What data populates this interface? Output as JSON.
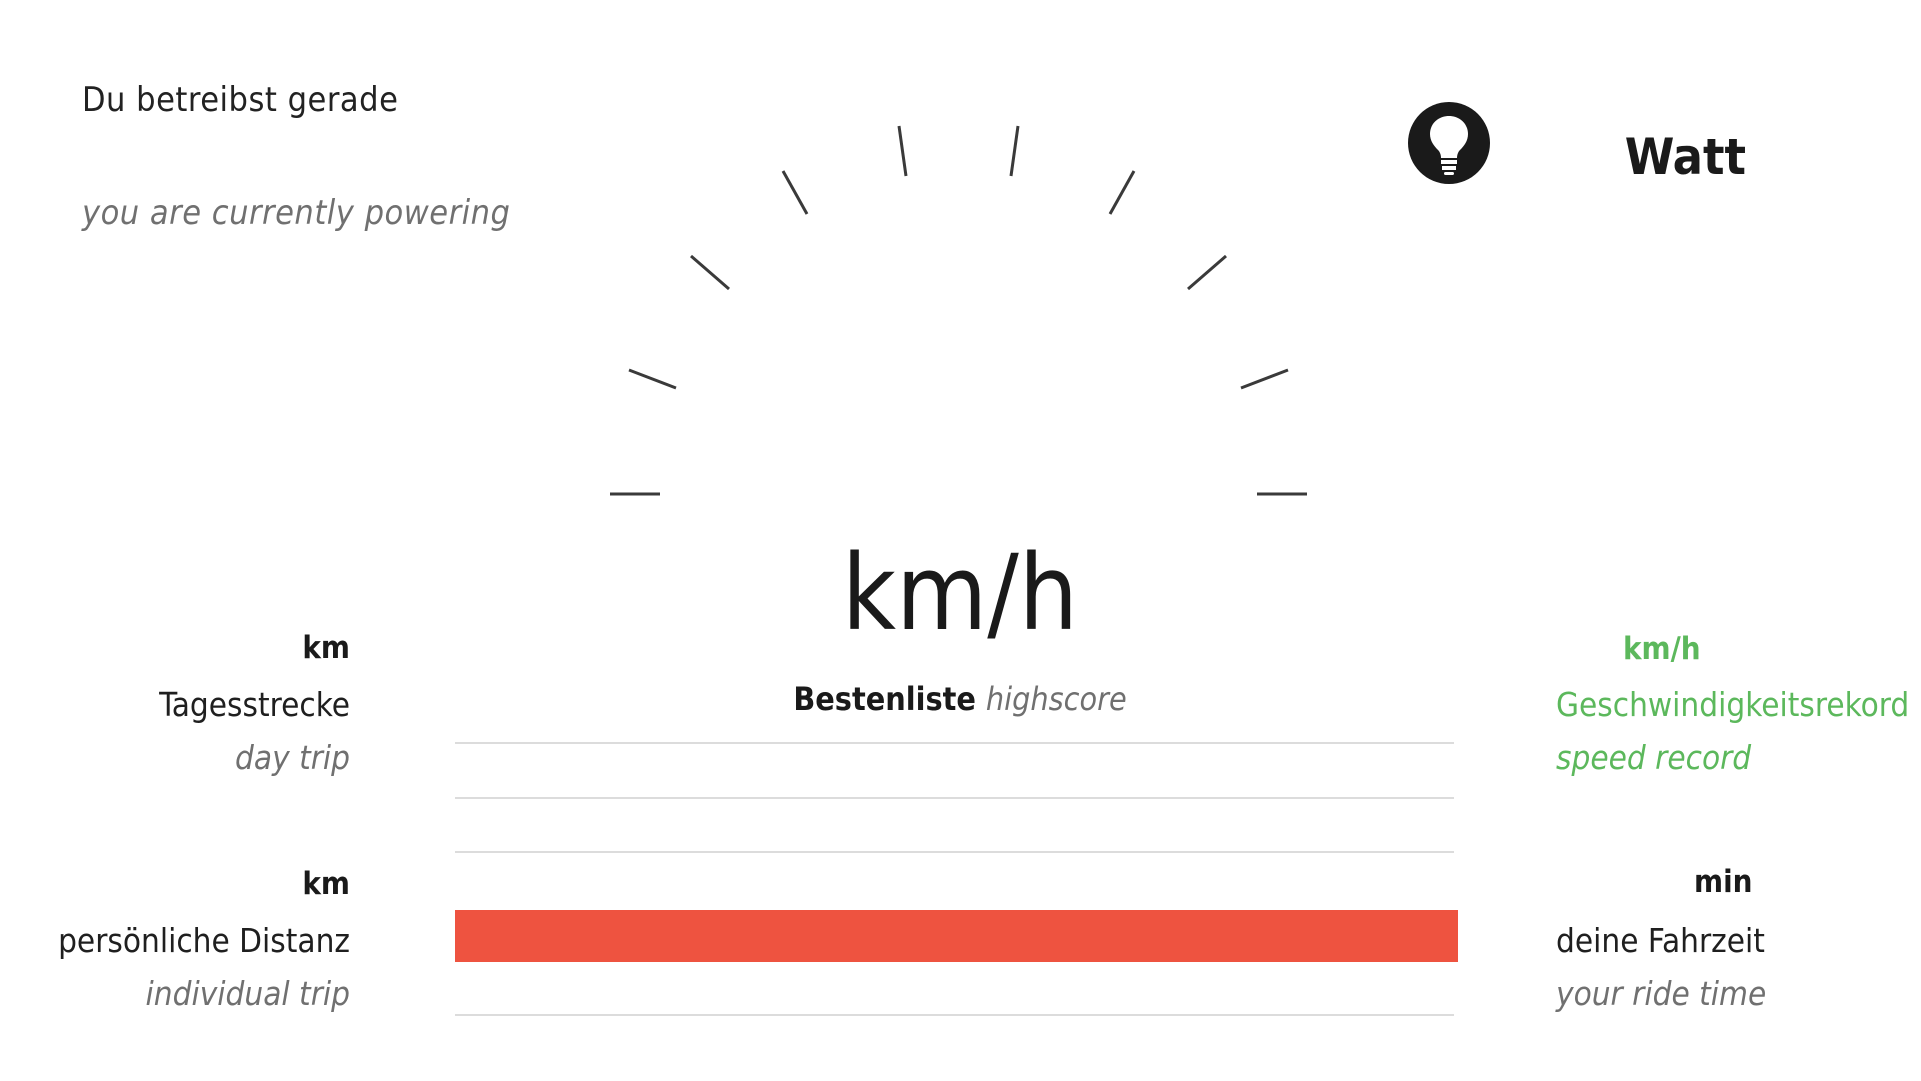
{
  "powering": {
    "label_de": "Du betreibst gerade",
    "label_en": "you are currently powering",
    "icon": "light-bulb-icon",
    "unit": "Watt"
  },
  "speed": {
    "unit": "km/h"
  },
  "day_trip": {
    "unit": "km",
    "label_de": "Tagesstrecke",
    "label_en": "day trip"
  },
  "individual_trip": {
    "unit": "km",
    "label_de": "persönliche Distanz",
    "label_en": "individual trip"
  },
  "speed_record": {
    "unit": "km/h",
    "label_de": "Geschwindigkeitsrekord",
    "label_en": "speed record",
    "color": "#5cb85c"
  },
  "ride_time": {
    "unit": "min",
    "label_de": "deine Fahrzeit",
    "label_en": "your ride time"
  },
  "highscore": {
    "label_de": "Bestenliste",
    "label_en": "highscore",
    "bar_color": "#ee5340",
    "highlighted_row": 3,
    "row_count": 5
  }
}
